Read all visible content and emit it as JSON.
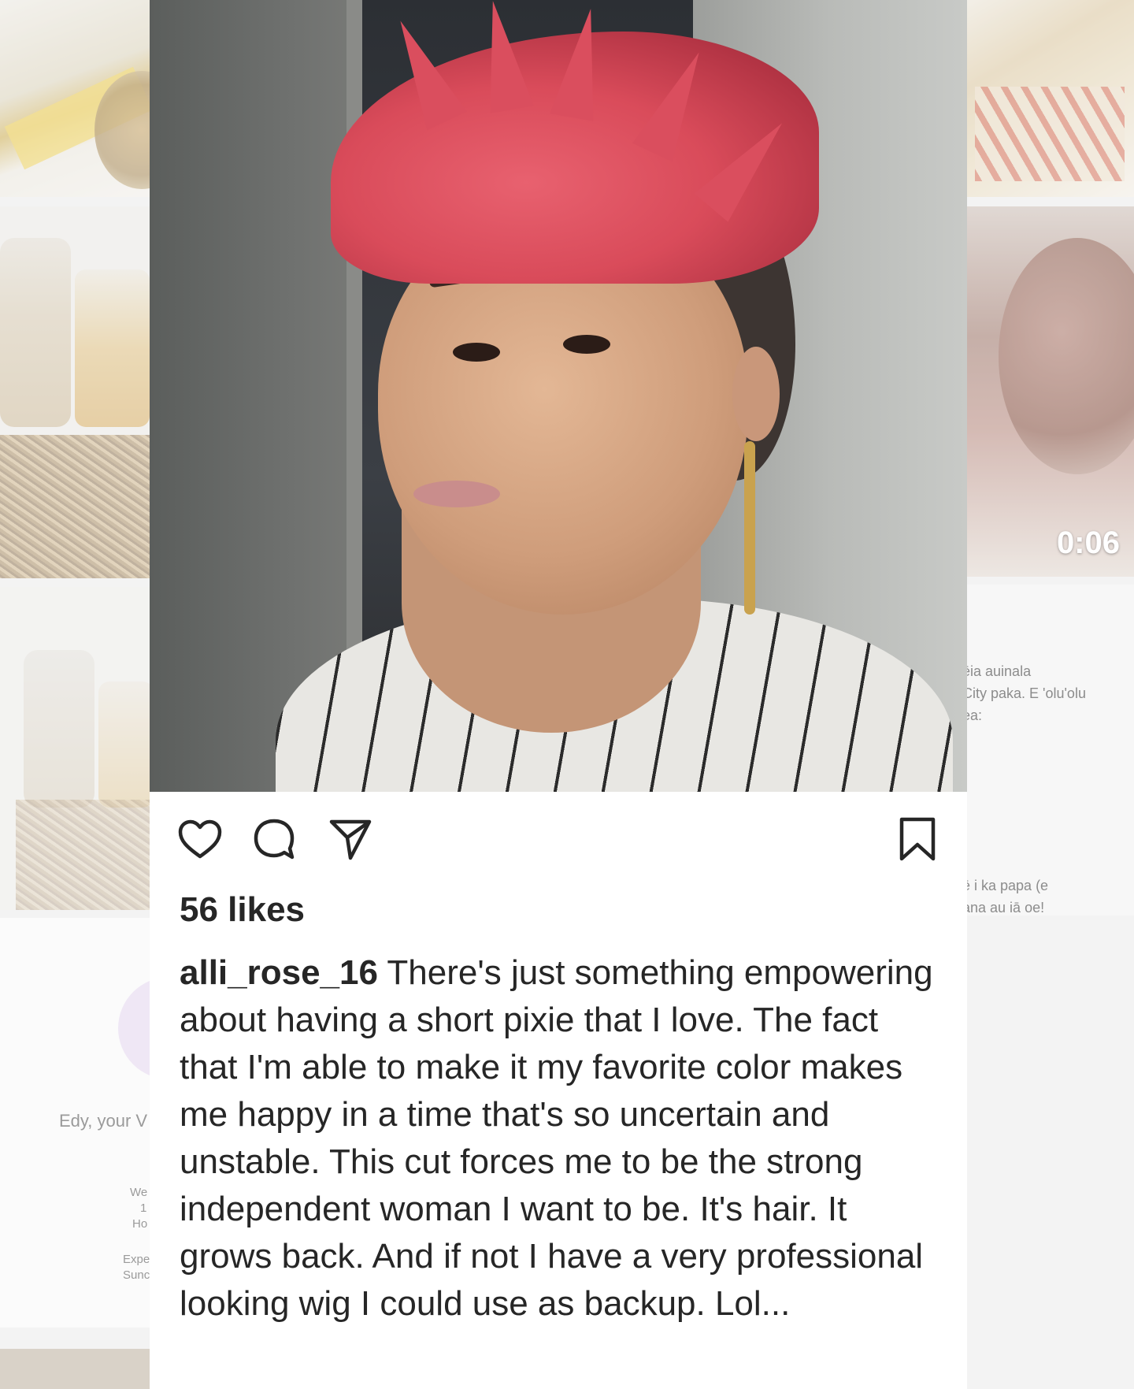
{
  "background": {
    "left_profile_caption": "Edy, your V",
    "left_small_lines": [
      "We",
      "1",
      "Ho",
      "Expe",
      "Sunc"
    ],
    "right_video_duration": "0:06",
    "right_text_lines_top": [
      "ēia auinala",
      "City paka.  E 'olu'olu",
      "ea:"
    ],
    "right_text_lines_bottom": [
      "ē i ka papa (e",
      "ana au iā oe!"
    ]
  },
  "post": {
    "likes": "56 likes",
    "username": "alli_rose_16",
    "caption_text": " There's just something empowering about having a short pixie that I love.  The fact that I'm able to make it my favorite color makes me happy in a time that's so uncertain and unstable. This cut forces me to be the strong independent woman I want to be. It's hair.  It grows back. And if not I have a very professional looking wig I could use as backup.  Lol...",
    "actions": {
      "like_icon": "heart-icon",
      "comment_icon": "comment-bubble-icon",
      "share_icon": "paper-plane-icon",
      "save_icon": "bookmark-icon"
    }
  },
  "colors": {
    "text": "#262626",
    "hair_accent": "#d94b5a"
  }
}
